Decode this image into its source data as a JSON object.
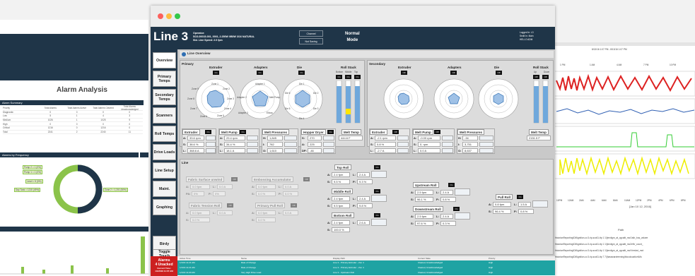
{
  "left_window": {
    "title": "Alarm Analysis",
    "summary_title": "Alarm Summary",
    "summary_headers": [
      "Priority",
      "Total Alarms",
      "Total Alarms Active",
      "Total Alarms Cleared",
      "Total Alarms Unacknowledged"
    ],
    "summary_rows": [
      [
        "Diagnostic",
        "0",
        "0",
        "0",
        "0"
      ],
      [
        "Low",
        "5",
        "1",
        "4",
        "3"
      ],
      [
        "Medium",
        "1026",
        "1",
        "1025",
        "9"
      ],
      [
        "High",
        "0",
        "0",
        "0",
        "0"
      ],
      [
        "Critical",
        "1216",
        "0",
        "1216",
        "0"
      ],
      [
        "Total",
        "2241",
        "2",
        "2240",
        "11"
      ]
    ],
    "freq_title": "Alarms by Frequency",
    "freq_labels": [
      "Pump 2 = 1 (0%)",
      "Pump 1 = 1 (0%)",
      "Level = 5 (0%)",
      "Day Tank = 1215 (49%)",
      "Zone 2 = 1,201 (50%)"
    ]
  },
  "right_window": {
    "date_range": "8/13/16 1:07 PM - 8/13/16 1:07 PM",
    "time_labels": [
      "1 PM",
      "1 AM",
      "4 AM",
      "7 PM",
      "10 PM"
    ],
    "xaxis_labels": [
      "10PM",
      "12AM",
      "2AM",
      "4AM",
      "6AM",
      "8AM",
      "10AM",
      "12PM",
      "2PM",
      "4PM",
      "6PM",
      "8PM"
    ],
    "xaxis_date": "[Jan 10 12, 2016]",
    "path_header": "Path",
    "paths": [
      "HistorianReporting\\D6\\ignition-cv.3-rip-scc61-ttp 1 1\\[enviigm_at_cgcaltt_mo/1stb_bus_valuee",
      "HistorianReporting\\D6\\ignition-cv.3-rip-scc61-ttp 1 1\\[enviigm_at_cgcaltt_mo2el\\t/_count_",
      "HistorianReporting\\D6\\ignition-cv.3-rip-scc61-ttp 1 1\\[enviigm_at_cgcaltt_mo/Vresbut_mot",
      "HistorianReporting\\D6\\ignition-cv.3-rip-scc61-ttp 7 7\\[hasswardreening\\blocolocation\\Mo"
    ]
  },
  "main_window": {
    "title": "Line 3",
    "operator_label": "Operator:",
    "order_info": "SO3-00015-001, 0001, 2.250W 0B0W 3/16 NATURAL",
    "line_speed": "Std. Line Speed: 2.0 fpm",
    "buttons": [
      "Channel",
      "Not Saving"
    ],
    "mode": [
      "Normal",
      "Mode"
    ],
    "login": [
      "Logged In: L3",
      "Sedit In: Main",
      "HELLO ADM"
    ],
    "nav": [
      "Overview",
      "Primary Temps",
      "Secondary Temps",
      "Scanners",
      "Roll Temps",
      "Drive Loads",
      "Line Setup",
      "Maint.",
      "Graphing",
      "Birdy",
      "Toggle Touch"
    ],
    "alarm": [
      "Alarms",
      "4 Unacked",
      "Current Time:",
      "1/1/2016 11:07 AM"
    ],
    "section_title": "Line Overview",
    "primary": {
      "label": "Primary",
      "gauges": [
        "Extruder",
        "Adapters",
        "Die"
      ],
      "roll_stack": "Roll Stack",
      "roll_cols": [
        "Bottom",
        "Middle",
        "Top"
      ],
      "roll_speed": "Up"
    },
    "secondary": {
      "label": "Secondary",
      "gauges": [
        "Extruder",
        "Adapters",
        "Die"
      ],
      "roll_stack": "Roll Stack",
      "roll_cols": [
        "Up",
        "Down"
      ]
    },
    "zone_labels": [
      "Zone 1",
      "Zone 2",
      "Zone 3",
      "Zone 4",
      "Zone 5",
      "Zone 6",
      "Zone 7",
      "Zone 8",
      "Zone 9",
      "Zone 10",
      "Adapter 1",
      "Adapter 2",
      "Melt Pump",
      "Elbow",
      "Adapter 3",
      "Die 1",
      "Die 2",
      "Die 3",
      "Die 4",
      "Die 5",
      "Die 6"
    ],
    "prim_extruder": {
      "label": "Extruder",
      "state": "On",
      "A": "33.6 rpm",
      "S": "38.6 %",
      "L": "368.6 A"
    },
    "prim_meltpump": {
      "label": "Melt Pump",
      "state": "On",
      "A": "29.4 rpm",
      "S": "34.4 %",
      "L": "18.1 A"
    },
    "prim_meltpress": {
      "label": "Melt Pressures",
      "H": "1,845",
      "I": "782",
      "O": "1,610"
    },
    "prim_hopper": {
      "label": "Hopper Dryer",
      "state": "On",
      "S": "270",
      "A": "225",
      "DP": "-46"
    },
    "prim_melttemp": {
      "label": "Melt Temp",
      "value": "444.6 F"
    },
    "sec_extruder": {
      "label": "Extruder",
      "state": "Off",
      "A": "-2.1 rpm",
      "S": "0.8 %",
      "L": "-2.7 A"
    },
    "sec_meltpump": {
      "label": "Melt Pump",
      "state": "Off",
      "A": "-0.00 rpm",
      "S": "0. rpm",
      "L": "0.0 A"
    },
    "sec_meltpress": {
      "label": "Melt Pressures",
      "H": "-34",
      "I": "3,751",
      "O": "8,637"
    },
    "sec_melttemp": {
      "label": "Melt Temp",
      "value": "2151.5 F"
    },
    "line_label": "Line",
    "fabric": {
      "label": "Fabric Surface unwind",
      "state": "Off",
      "A": "0.0 fpm",
      "L": "0.0 A",
      "PA": "0%",
      "P": "0%"
    },
    "fabric_tension": {
      "label": "Fabric Tension Roll",
      "state": "Off",
      "A": "0.0 fpm",
      "L": "0.0 A",
      "S": "0.0 %"
    },
    "embossing": {
      "label": "Embossing Accumulator",
      "state": "Off",
      "A": "0.0 fpm",
      "L": "0.0 A",
      "S": "0.0 %",
      "P": "0.0 %"
    },
    "primary_pull": {
      "label": "Primary Pull Roll",
      "state": "Off",
      "A": "0.0 fpm",
      "L": "0.0 A",
      "S": "0.0 %"
    },
    "top_roll": {
      "label": "Top Roll",
      "state": "On",
      "A": "2.4 fpm",
      "L": "2.4 A",
      "S": "9.5 %",
      "P": "9.3 %"
    },
    "middle_roll": {
      "label": "Middle Roll",
      "state": "On",
      "A": "2.4 fpm",
      "L": "2.4 A",
      "S": "9.5 fpm",
      "P": "9.8 %"
    },
    "bottom_roll": {
      "label": "Bottom Roll",
      "state": "On",
      "A": "2.4 fpm",
      "L": "2.6 A",
      "S": "100.0 %"
    },
    "upstream_roll": {
      "label": "Upstream Roll",
      "state": "On",
      "A": "2.5 fpm",
      "L": "2.4 A",
      "S": "96.1 %",
      "P": "0.8 %"
    },
    "downstream_roll": {
      "label": "Downstream Roll",
      "state": "On",
      "A": "2.5 fpm",
      "L": "2.4 A",
      "S": "97.6 %",
      "P": "0.3 %"
    },
    "pull_roll": {
      "label": "Pull Roll",
      "state": "On",
      "A": "0.8 fpm",
      "L": "1.5 A",
      "S": "96.4 %",
      "P": "0.8 %"
    },
    "alarm_table": {
      "headers": [
        "Active Time",
        "Name",
        "Display Path",
        "Current State",
        "Priority"
      ],
      "rows": [
        [
          "1/1/16 11:21 AM",
          "Rate of Change",
          "Line 3 - Primary Extruder - Zon 4",
          "Cleared, Unacknowledged",
          "High"
        ],
        [
          "1/1/16 11:21 AM",
          "Rate of Change",
          "Line 3 - Primary Extruder - Zon 4",
          "Cleared, Unacknowledged",
          "High"
        ],
        [
          "1/1/16 11:20 AM",
          "Very High Drive Load",
          "Line 3 - Upstream Roll",
          "Cleared, Unacknowledged",
          "High"
        ]
      ]
    }
  },
  "colors": {
    "navy": "#1f3548",
    "alarm_red": "#cc1f1f",
    "teal": "#1fa3a3",
    "gauge_blue": "#2f6fb3",
    "trend_red": "#d22",
    "trend_green": "#3c3",
    "trend_yellow": "#ee0"
  }
}
